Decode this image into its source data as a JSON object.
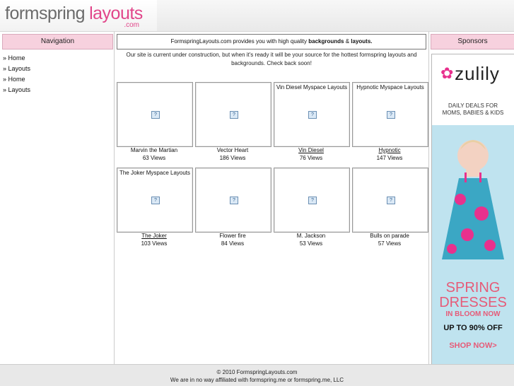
{
  "logo": {
    "form_text": "formspring",
    "layouts_text": "layouts",
    "com_text": ".com"
  },
  "navigation": {
    "heading": "Navigation",
    "items": [
      {
        "label": "» Home"
      },
      {
        "label": "» Layouts"
      },
      {
        "label": "» Home"
      },
      {
        "label": "» Layouts"
      }
    ]
  },
  "sponsors": {
    "heading": "Sponsors",
    "ad": {
      "brand": "zulily",
      "tagline_1": "DAILY DEALS FOR",
      "tagline_2": "MOMS, BABIES & KIDS",
      "headline_1": "SPRING",
      "headline_2": "DRESSES",
      "sub": "IN BLOOM NOW",
      "offer": "UP TO 90% OFF",
      "cta": "SHOP NOW>"
    }
  },
  "main": {
    "banner_prefix": "FormspringLayouts.com provides you with high quality ",
    "banner_bold_1": "backgrounds",
    "banner_mid": " & ",
    "banner_bold_2": "layouts.",
    "intro": "Our site is current under construction, but when it's ready it will be your source for the hottest formspring layouts and backgrounds. Check back soon!",
    "layouts": [
      {
        "title": "",
        "name": "Marvin the Martian",
        "views": "63 Views"
      },
      {
        "title": "",
        "name": "Vector Heart",
        "views": "186 Views"
      },
      {
        "title": "Vin Diesel Myspace Layouts",
        "name": "Vin Diesel",
        "views": "76 Views"
      },
      {
        "title": "Hypnotic Myspace Layouts",
        "name": "Hypnotic",
        "views": "147 Views"
      },
      {
        "title": "The Joker Myspace Layouts",
        "name": "The Joker",
        "views": "103 Views"
      },
      {
        "title": "",
        "name": "Flower fire",
        "views": "84 Views"
      },
      {
        "title": "",
        "name": "M. Jackson",
        "views": "53 Views"
      },
      {
        "title": "",
        "name": "Bulls on parade",
        "views": "57 Views"
      }
    ]
  },
  "footer": {
    "copyright": "© 2010 FormspringLayouts.com",
    "disclaimer": "We are in no way affiliated with formspring.me or formspring.me, LLC"
  }
}
